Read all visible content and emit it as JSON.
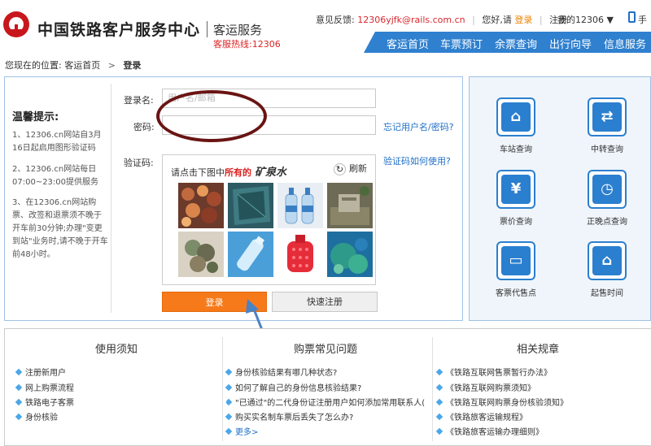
{
  "header": {
    "logo_text": "中国铁路客户服务中心",
    "sub_title": "客运服务",
    "hotline": "客服热线:12306",
    "feedback_label": "意见反馈:",
    "feedback_email": "12306yjfk@rails.com.cn",
    "greeting": "您好,请",
    "login_link": "登录",
    "register_link": "注册",
    "my12306": "我的12306 ▼",
    "phone_text": "手"
  },
  "nav": {
    "items": [
      "客运首页",
      "车票预订",
      "余票查询",
      "出行向导",
      "信息服务"
    ]
  },
  "breadcrumb": {
    "prefix": "您现在的位置:",
    "home": "客运首页",
    "arrow": ">",
    "current": "登录"
  },
  "tips": {
    "title": "温馨提示:",
    "items": [
      "1、12306.cn网站自3月16日起启用图形验证码",
      "2、12306.cn网站每日07:00~23:00提供服务",
      "3、在12306.cn网站购票、改签和退票须不晚于开车前30分钟;办理\"变更到站\"业务时,请不晚于开车前48小时。"
    ]
  },
  "form": {
    "username_label": "登录名:",
    "username_placeholder": "用户名/邮箱",
    "password_label": "密码:",
    "forgot_link": "忘记用户名/密码?",
    "captcha_label": "验证码:",
    "captcha_help_link": "验证码如何使用?",
    "captcha_prompt": "请点击下图中",
    "captcha_prompt_red": "所有的",
    "captcha_target": "矿泉水",
    "refresh_label": "刷新",
    "login_button": "登录",
    "register_button": "快速注册"
  },
  "quick_services": [
    {
      "label": "车站查询",
      "icon": "station-icon"
    },
    {
      "label": "中转查询",
      "icon": "transfer-icon"
    },
    {
      "label": "票价查询",
      "icon": "fare-search-icon"
    },
    {
      "label": "正晚点查询",
      "icon": "clock-icon"
    },
    {
      "label": "客票代售点",
      "icon": "ticket-agent-icon"
    },
    {
      "label": "起售时间",
      "icon": "sale-time-icon"
    }
  ],
  "bottom": {
    "usage": {
      "title": "使用须知",
      "items": [
        "注册新用户",
        "网上购票流程",
        "铁路电子客票",
        "身份核验"
      ]
    },
    "faq": {
      "title": "购票常见问题",
      "items": [
        "身份核验结果有哪几种状态?",
        "如何了解自己的身份信息核验结果?",
        "\"已通过\"的二代身份证注册用户如何添加常用联系人(",
        "购买实名制车票后丢失了怎么办?"
      ],
      "more": "更多>"
    },
    "rules": {
      "title": "相关规章",
      "items": [
        "《铁路互联网售票暂行办法》",
        "《铁路互联网购票须知》",
        "《铁路互联网购票身份核验须知》",
        "《铁路旅客运输规程》",
        "《铁路旅客运输办理细则》"
      ]
    }
  },
  "colors": {
    "brand_red": "#c8161d",
    "nav_blue": "#2f80cf",
    "login_orange": "#f67a1a",
    "link_blue": "#1f6fc6"
  }
}
